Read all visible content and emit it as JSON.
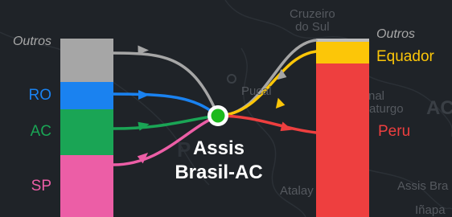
{
  "hub": {
    "line1": "Assis",
    "line2": "Brasil-AC",
    "ring_color": "#ffffff",
    "dot_color": "#1db91d"
  },
  "origins": [
    {
      "label": "Outros",
      "color": "#a6a6a6"
    },
    {
      "label": "RO",
      "color": "#1a82f0"
    },
    {
      "label": "AC",
      "color": "#1aa555"
    },
    {
      "label": "SP",
      "color": "#ec5ea6"
    }
  ],
  "destinations": [
    {
      "label": "Outros",
      "color": "#a6a6a6"
    },
    {
      "label": "Equador",
      "color": "#fcc608"
    },
    {
      "label": "Peru",
      "color": "#ee3f3f"
    }
  ],
  "background_map": {
    "place_labels": [
      "Cruzeiro\ndo Sul",
      "Pucal",
      "nal",
      "aturgo",
      "AC",
      "Atalay",
      "Assis Bra",
      "Iñapa"
    ]
  }
}
